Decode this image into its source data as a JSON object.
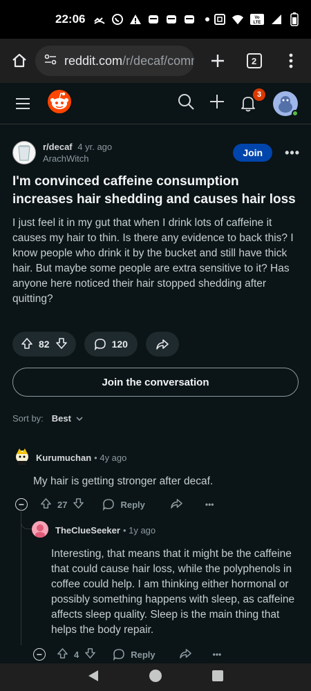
{
  "status_bar": {
    "time": "22:06",
    "left_icons": [
      "missed-call-icon",
      "whatsapp-icon",
      "warning-icon",
      "message-icon",
      "message-icon",
      "message-icon",
      "dot-icon"
    ],
    "right_icons": [
      "nfc-icon",
      "wifi-icon",
      "volte-icon",
      "signal-icon",
      "battery-icon"
    ],
    "volte_label": "Vo LTE"
  },
  "browser": {
    "url_host": "reddit.com",
    "url_path": "/r/decaf/comm",
    "tab_count": "2"
  },
  "reddit_header": {
    "notification_count": "3"
  },
  "post": {
    "subreddit": "r/decaf",
    "age": "4 yr. ago",
    "author": "ArachWitch",
    "join_label": "Join",
    "more_label": "•••",
    "title": "I'm convinced caffeine consumption increases hair shedding and causes hair loss",
    "body": "I just feel it in my gut that when I drink lots of caffeine it causes my hair to thin. Is there any evidence to back this? I know people who drink it by the bucket and still have thick hair. But maybe some people are extra sensitive to it? Has anyone here noticed their hair stopped shedding after quitting?",
    "votes": "82",
    "comments": "120"
  },
  "join_conversation": "Join the conversation",
  "sort": {
    "label": "Sort by:",
    "value": "Best"
  },
  "comments": [
    {
      "user": "Kurumuchan",
      "age": "• 4y ago",
      "body": "My hair is getting stronger after decaf.",
      "votes": "27",
      "reply_label": "Reply",
      "more_label": "•••"
    },
    {
      "user": "TheClueSeeker",
      "age": "• 1y ago",
      "body": "Interesting, that means that it might be the caffeine that could cause hair loss, while the polyphenols in coffee could help. I am thinking either hormonal or possibly something happens with sleep, as caffeine affects sleep quality. Sleep is the main thing that helps the body repair.",
      "votes": "4",
      "reply_label": "Reply",
      "more_label": "•••"
    }
  ],
  "colors": {
    "page_bg": "#0b1416",
    "join_blue": "#0045ac",
    "badge_orange": "#d93900",
    "reddit_orange": "#ff4500"
  }
}
